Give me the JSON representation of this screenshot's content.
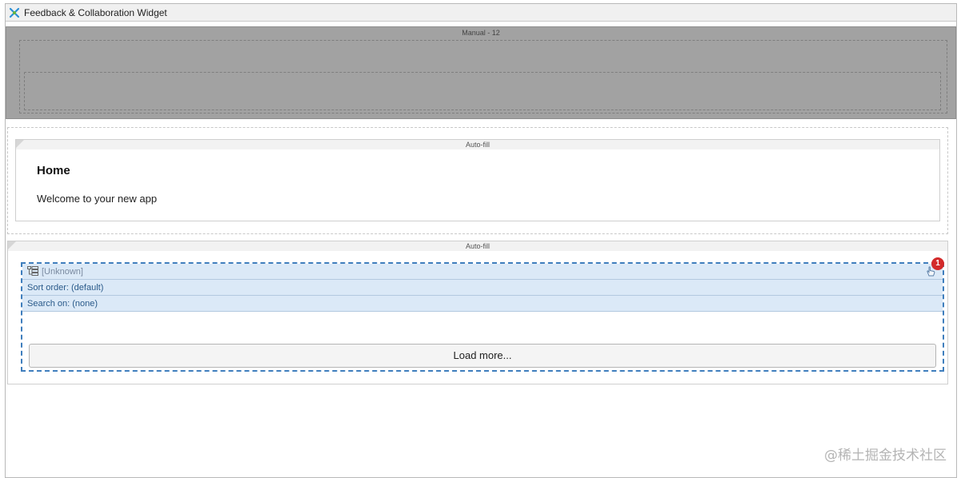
{
  "window": {
    "title": "Feedback & Collaboration Widget"
  },
  "header": {
    "caption": "Manual - 12"
  },
  "home_section": {
    "caption": "Auto-fill",
    "title": "Home",
    "text": "Welcome to your new app"
  },
  "gallery_section": {
    "caption": "Auto-fill",
    "source": "[Unknown]",
    "sort_order": "Sort order: (default)",
    "search_on": "Search on: (none)",
    "badge_count": "1",
    "load_more_label": "Load more..."
  },
  "watermark": "@稀土掘金技术社区",
  "colors": {
    "selection": "#3f7ebd",
    "row_bg": "#dbe9f7",
    "badge": "#d32a2a",
    "header_region": "#a2a2a2"
  },
  "icons": {
    "app": "app-logo-icon",
    "data_source": "data-source-icon",
    "pointer": "hand-pointer-icon"
  }
}
